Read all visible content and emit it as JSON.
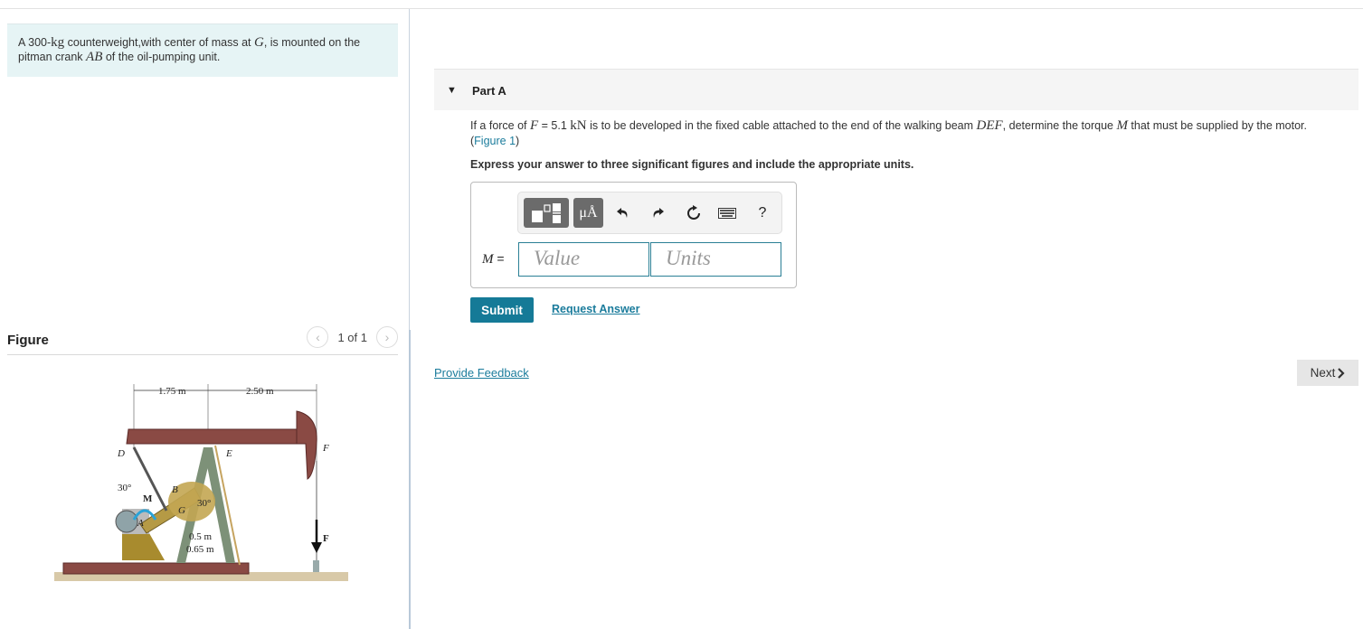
{
  "intro": {
    "prefix": "A 300-",
    "unit": "kg",
    "mid": " counterweight,with center of mass at ",
    "var_g": "G",
    "mid2": ", is mounted on the pitman crank ",
    "var_ab": "AB",
    "suffix": " of the oil-pumping unit."
  },
  "figure": {
    "title": "Figure",
    "pager_text": "1 of 1",
    "prev_icon": "chevron-left-icon",
    "next_icon": "chevron-right-icon",
    "labels": {
      "dim1": "1.75 m",
      "dim2": "2.50 m",
      "d": "D",
      "e": "E",
      "f_point": "F",
      "f_force": "F",
      "angle1": "30°",
      "angle2": "30°",
      "m": "M",
      "a": "A",
      "b": "B",
      "g": "G",
      "r1": "0.5 m",
      "r2": "0.65 m"
    }
  },
  "part": {
    "title": "Part A",
    "question_prefix": "If a force of ",
    "var_f": "F",
    "question_eq": " = 5.1 ",
    "unit_kn": "kN",
    "question_mid": " is to be developed in the fixed cable attached to the end of the walking beam ",
    "var_def": "DEF",
    "question_mid2": ", determine the torque ",
    "var_m": "M",
    "question_suffix": " that must be supplied by the motor.",
    "figure_link": "Figure 1",
    "instruction": "Express your answer to three significant figures and include the appropriate units."
  },
  "answer": {
    "label": "M",
    "equals": " =",
    "value_placeholder": "Value",
    "units_placeholder": "Units",
    "toolbar": {
      "units_symbol": "μÅ",
      "help": "?"
    }
  },
  "actions": {
    "submit": "Submit",
    "request_answer": "Request Answer",
    "provide_feedback": "Provide Feedback",
    "next": "Next"
  }
}
